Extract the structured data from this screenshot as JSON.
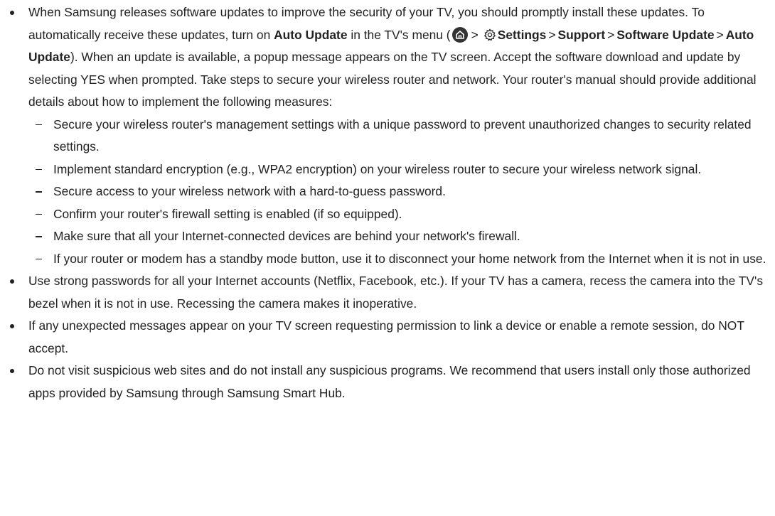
{
  "bullets": [
    {
      "t1": "When Samsung releases software updates to improve the security of your TV, you should promptly install these updates. To automatically receive these updates, turn on ",
      "auto_update": "Auto Update",
      "t2": " in the TV's menu (",
      "sep": ">",
      "settings": "Settings",
      "support": "Support",
      "software_update": "Software Update",
      "auto_update_2": "Auto Update",
      "t3": "). When an update is available, a popup message appears on the TV screen. Accept the software download and update by selecting YES when prompted. Take steps to secure your wireless router and network. Your router's manual should provide additional details about how to implement the following measures:",
      "sub_items": [
        "Secure your wireless router's management settings with a unique password to prevent unauthorized changes to security related settings.",
        "Implement standard encryption (e.g., WPA2 encryption) on your wireless router to secure your wireless network signal.",
        "Secure access to your wireless network with a hard-to-guess password.",
        "Confirm your router's firewall setting is enabled (if so equipped).",
        "Make sure that all your Internet-connected devices are behind your network's firewall.",
        "If your router or modem has a standby mode button, use it to disconnect your home network from the Internet when it is not in use."
      ]
    },
    {
      "text": "Use strong passwords for all your Internet accounts (Netflix, Facebook, etc.). If your TV has a camera, recess the camera into the TV's bezel when it is not in use. Recessing the camera makes it inoperative."
    },
    {
      "text": "If any unexpected messages appear on your TV screen requesting permission to link a device or enable a remote session, do NOT accept."
    },
    {
      "text": "Do not visit suspicious web sites and do not install any suspicious programs. We recommend that users install only those authorized apps provided by Samsung through Samsung Smart Hub."
    }
  ],
  "icons": {
    "home": "home-icon",
    "settings": "settings-gear-icon"
  },
  "colors": {
    "text": "#222222",
    "icon_bg": "#333333",
    "icon_fg": "#ffffff"
  }
}
